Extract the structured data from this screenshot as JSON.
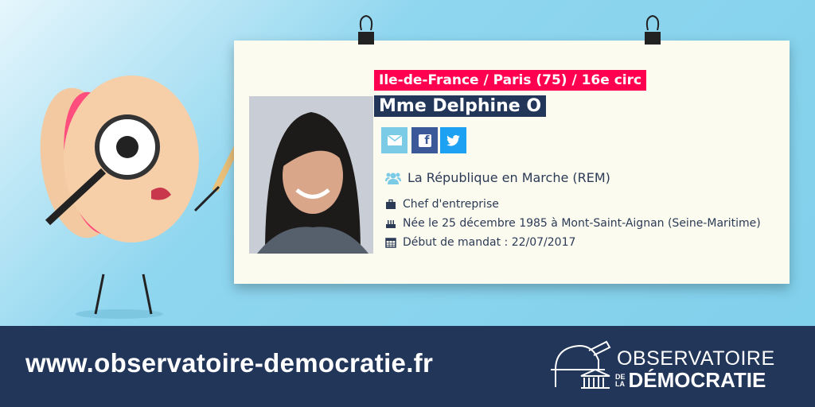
{
  "card": {
    "constituency": "Ile-de-France / Paris (75) / 16e circ",
    "name": "Mme Delphine O",
    "social": [
      {
        "icon": "envelope-icon",
        "color": "#7ccbe6"
      },
      {
        "icon": "facebook-icon",
        "color": "#3b5998"
      },
      {
        "icon": "twitter-icon",
        "color": "#1da1f2"
      }
    ],
    "party": "La République en Marche (REM)",
    "profession": "Chef d'entreprise",
    "birth": "Née le 25 décembre 1985 à Mont-Saint-Aignan (Seine-Maritime)",
    "mandate_start": "Début de mandat : 22/07/2017"
  },
  "footer": {
    "url": "www.observatoire-democratie.fr",
    "logo": {
      "line1": "OBSERVATOIRE",
      "de": "DE",
      "la": "LA",
      "line2": "DÉMOCRATIE"
    }
  },
  "colors": {
    "accent": "#ff0050",
    "navy": "#22365a"
  }
}
